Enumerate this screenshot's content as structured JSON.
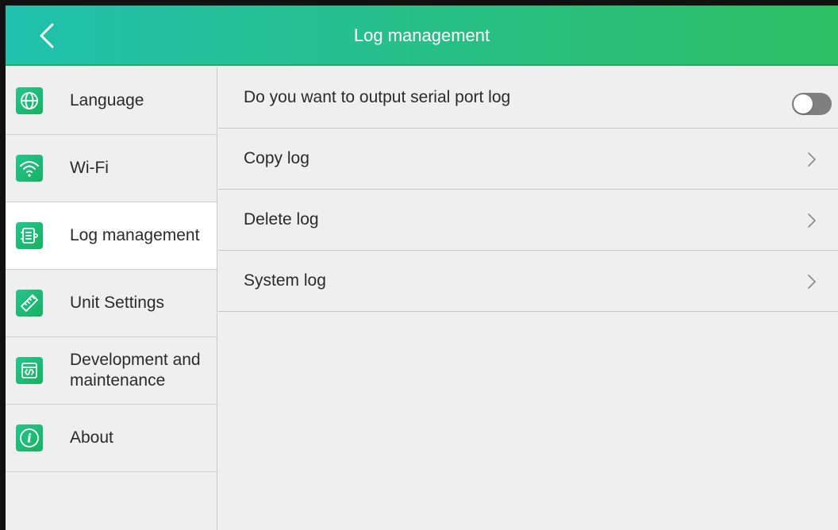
{
  "header": {
    "title": "Log management",
    "back_icon": "chevron-left-icon",
    "gradient": [
      "#1fc1ad",
      "#2cbf63"
    ]
  },
  "sidebar": {
    "items": [
      {
        "label": "Language",
        "icon": "globe-icon",
        "active": false
      },
      {
        "label": "Wi-Fi",
        "icon": "wifi-icon",
        "active": false
      },
      {
        "label": "Log management",
        "icon": "log-icon",
        "active": true
      },
      {
        "label": "Unit Settings",
        "icon": "ruler-icon",
        "active": false
      },
      {
        "label": "Development and maintenance",
        "icon": "code-icon",
        "active": false
      },
      {
        "label": "About",
        "icon": "info-icon",
        "active": false
      }
    ]
  },
  "main": {
    "rows": [
      {
        "label": "Do you want to output serial port log",
        "control": "toggle",
        "value": false
      },
      {
        "label": "Copy log",
        "control": "chevron-right-icon"
      },
      {
        "label": "Delete log",
        "control": "chevron-right-icon"
      },
      {
        "label": "System log",
        "control": "chevron-right-icon"
      }
    ]
  },
  "colors": {
    "accent": "#24bf7f",
    "active_item_bg": "#ffffff",
    "toggle_off": "#7f7f7f"
  }
}
